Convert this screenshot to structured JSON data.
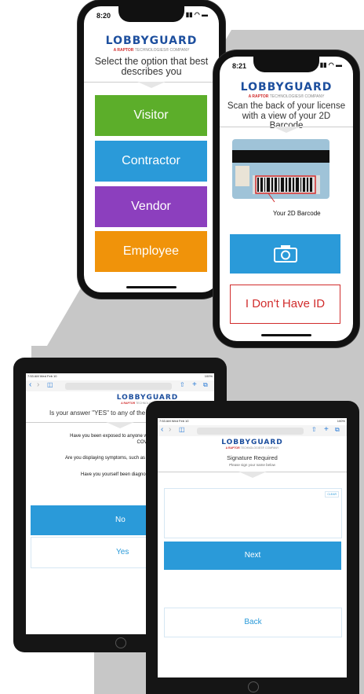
{
  "colors": {
    "background_grey": "#c7c7c7",
    "visitor_green": "#5cae2a",
    "contractor_blue": "#2a9ad9",
    "vendor_purple": "#8c3fbe",
    "employee_orange": "#f0930a",
    "primary_blue": "#2a9ad9",
    "danger_red": "#d12c2c",
    "logo_blue": "#1d4f9e"
  },
  "brand": {
    "logo_text": "LOBBYGUARD",
    "tagline_prefix": "A RAPTOR",
    "tagline_suffix": "TECHNOLOGIES® COMPANY"
  },
  "phone_select": {
    "time": "8:20",
    "prompt": "Select the option that best describes you",
    "options": [
      {
        "label": "Visitor"
      },
      {
        "label": "Contractor"
      },
      {
        "label": "Vendor"
      },
      {
        "label": "Employee"
      }
    ]
  },
  "phone_scan": {
    "time": "8:21",
    "prompt": "Scan the back of your license with a view of your 2D Barcode",
    "barcode_caption": "Your 2D Barcode",
    "camera_icon": "camera-icon",
    "no_id_label": "I Don't Have ID"
  },
  "tablet_covid": {
    "status_time": "7:53 AM  Wed Feb 10",
    "battery": "100%",
    "question": "Is your answer \"YES\" to any of the q",
    "items": [
      "Have you been exposed to anyone who has been ... COVID-19?",
      "Are you displaying symptoms, such as a fe",
      "Have you yourself been diagnosed wi"
    ],
    "item1_line1": "Have you been exposed to anyone who has been",
    "item1_line2": "COVID-19?",
    "no_label": "No",
    "yes_label": "Yes"
  },
  "tablet_signature": {
    "status_time": "7:53 AM  Wed Feb 10",
    "battery": "100%",
    "title": "Signature Required",
    "subtitle": "Please sign your name below",
    "clear_label": "CLEAR",
    "next_label": "Next",
    "back_label": "Back"
  }
}
